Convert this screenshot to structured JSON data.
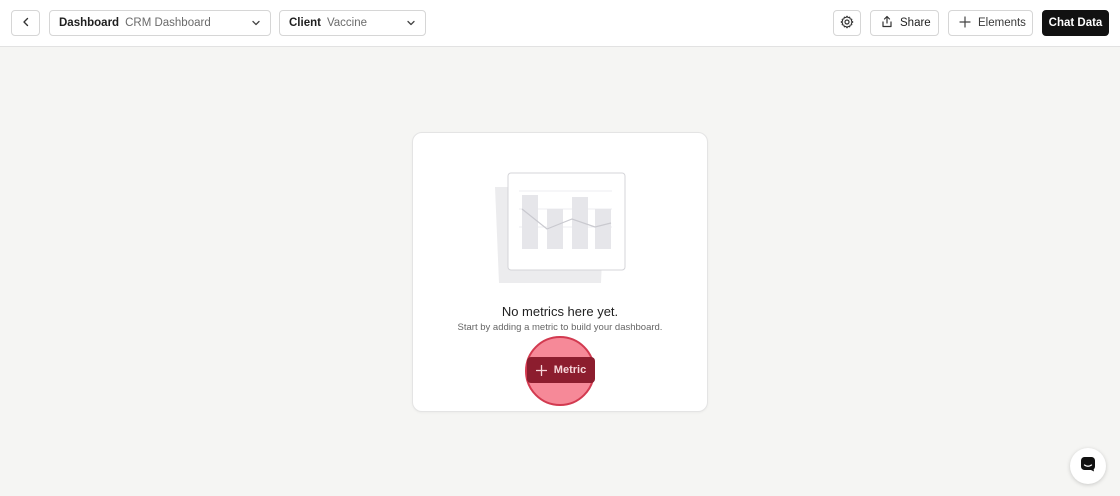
{
  "header": {
    "dashboard_label": "Dashboard",
    "dashboard_value": "CRM Dashboard",
    "client_label": "Client",
    "client_value": "Vaccine",
    "share_label": "Share",
    "elements_label": "Elements",
    "chat_label": "Chat Data"
  },
  "empty_state": {
    "title": "No metrics here yet.",
    "subtitle": "Start by adding a metric to build your dashboard.",
    "button_label": "Metric"
  },
  "icons": {
    "back": "chevron-left-icon",
    "dropdown": "chevron-down-icon",
    "settings": "gear-icon",
    "share": "share-icon",
    "add": "plus-icon",
    "chat": "chat-bubble-icon"
  },
  "colors": {
    "accent_dark": "#111111",
    "highlight_ring": "#f35c70",
    "metric_button": "#8c1d2e",
    "background": "#f5f5f3"
  }
}
